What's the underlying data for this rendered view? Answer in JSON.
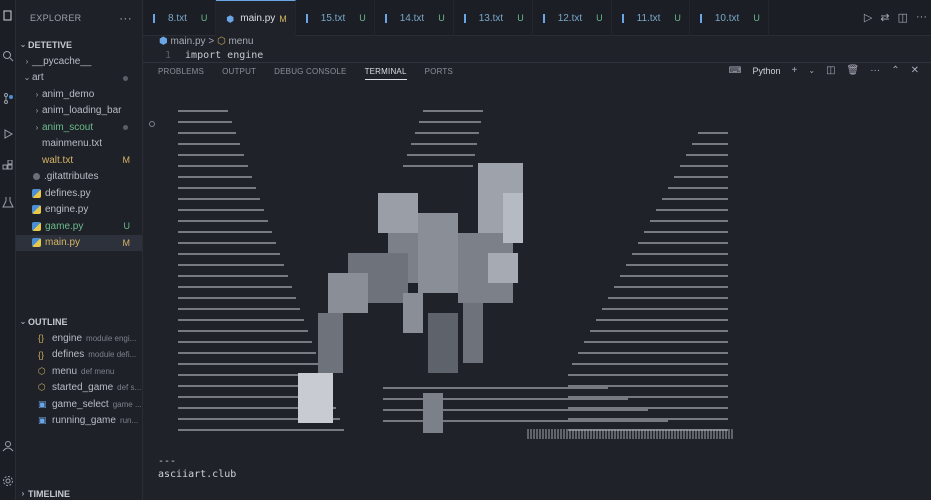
{
  "sidebar": {
    "title": "EXPLORER",
    "more": "···",
    "workspace": "DETETIVE",
    "files": [
      {
        "label": "__pycache__",
        "indent": 1,
        "twistie": "›"
      },
      {
        "label": "art",
        "indent": 1,
        "twistie": "⌄",
        "dot": true,
        "color": "#b9bcc4"
      },
      {
        "label": "anim_demo",
        "indent": 2,
        "twistie": "›"
      },
      {
        "label": "anim_loading_bar",
        "indent": 2,
        "twistie": "›"
      },
      {
        "label": "anim_scout",
        "indent": 2,
        "twistie": "›",
        "dot": true,
        "color": "#6cbb8a"
      },
      {
        "label": "mainmenu.txt",
        "indent": 2
      },
      {
        "label": "walt.txt",
        "indent": 2,
        "badge": "M",
        "color": "#d6b566"
      },
      {
        "label": ".gitattributes",
        "indent": 1,
        "icon": "git"
      },
      {
        "label": "defines.py",
        "indent": 1,
        "icon": "py"
      },
      {
        "label": "engine.py",
        "indent": 1,
        "icon": "py"
      },
      {
        "label": "game.py",
        "indent": 1,
        "icon": "py",
        "badge": "U",
        "color": "#6cbb8a"
      },
      {
        "label": "main.py",
        "indent": 1,
        "icon": "py",
        "badge": "M",
        "color": "#d6b566",
        "selected": true
      }
    ],
    "outline_title": "OUTLINE",
    "outline": [
      {
        "icon": "{}",
        "label": "engine",
        "sub": "module engi..."
      },
      {
        "icon": "{}",
        "label": "defines",
        "sub": "module defi..."
      },
      {
        "icon": "⬡",
        "label": "menu",
        "sub": "def menu"
      },
      {
        "icon": "⬡",
        "label": "started_game",
        "sub": "def s..."
      },
      {
        "icon": "▣",
        "label": "game_select",
        "sub": "game ..."
      },
      {
        "icon": "▣",
        "label": "running_game",
        "sub": "run..."
      }
    ],
    "timeline_title": "TIMELINE"
  },
  "tabs": [
    {
      "label": "8.txt",
      "mark": "U"
    },
    {
      "label": "main.py",
      "mark": "M",
      "active": true
    },
    {
      "label": "15.txt",
      "mark": "U"
    },
    {
      "label": "14.txt",
      "mark": "U"
    },
    {
      "label": "13.txt",
      "mark": "U"
    },
    {
      "label": "12.txt",
      "mark": "U"
    },
    {
      "label": "11.txt",
      "mark": "U"
    },
    {
      "label": "10.txt",
      "mark": "U"
    }
  ],
  "editor": {
    "breadcrumb_file": "main.py",
    "breadcrumb_sep": ">",
    "breadcrumb_symbol": "menu",
    "line_number": "1",
    "code_line": "import engine"
  },
  "panel": {
    "tabs": [
      "PROBLEMS",
      "OUTPUT",
      "DEBUG CONSOLE",
      "TERMINAL",
      "PORTS"
    ],
    "active_tab": "TERMINAL",
    "shell": "Python",
    "terminal_footer": "---\nasciiart.club"
  },
  "colors": {
    "accent": "#6aa5e6",
    "modified": "#d6b566",
    "untracked": "#6cbb8a"
  }
}
